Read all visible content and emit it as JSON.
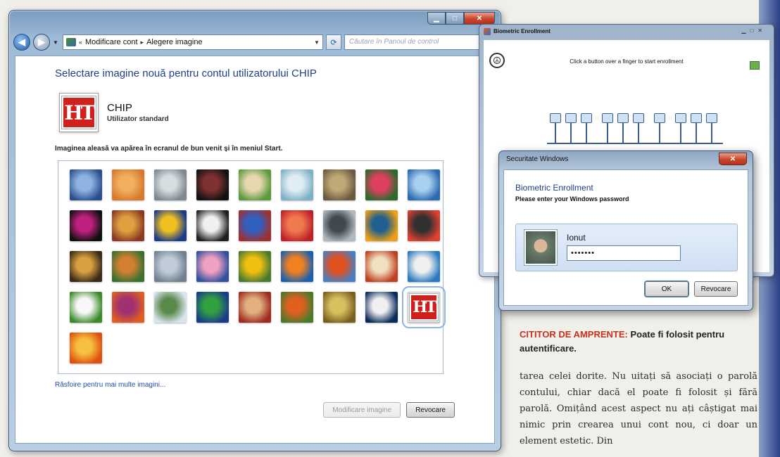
{
  "main_window": {
    "breadcrumb": [
      "Modificare cont",
      "Alegere imagine"
    ],
    "search_placeholder": "Căutare în Panoul de control",
    "title": "Selectare imagine nouă pentru contul utilizatorului CHIP",
    "user": {
      "name": "CHIP",
      "type": "Utilizator standard",
      "logo_text": "HT"
    },
    "instruction": "Imaginea aleasă va apărea în ecranul de bun venit și în meniul Start.",
    "pictures": [
      {
        "name": "robot-arm",
        "colors": [
          "#2a4f8f",
          "#8fb3e0"
        ]
      },
      {
        "name": "starfish",
        "colors": [
          "#d7782a",
          "#f0b060"
        ]
      },
      {
        "name": "robot",
        "colors": [
          "#7d8890",
          "#d8dde0"
        ]
      },
      {
        "name": "record",
        "colors": [
          "#111111",
          "#803030"
        ]
      },
      {
        "name": "cat",
        "colors": [
          "#5a9a3a",
          "#e8d8b0"
        ]
      },
      {
        "name": "gyroscope",
        "colors": [
          "#7fb0c8",
          "#e0eef4"
        ]
      },
      {
        "name": "rocks",
        "colors": [
          "#6a5a40",
          "#c0a878"
        ]
      },
      {
        "name": "flower-red",
        "colors": [
          "#2a6a2a",
          "#e04060"
        ]
      },
      {
        "name": "wheel",
        "colors": [
          "#2a6ab0",
          "#a8d0f0"
        ]
      },
      {
        "name": "ball-swirl",
        "colors": [
          "#101010",
          "#c02080"
        ]
      },
      {
        "name": "fabric",
        "colors": [
          "#8a3a20",
          "#e0a040"
        ]
      },
      {
        "name": "leaf-yellow",
        "colors": [
          "#1a3a8a",
          "#f0c020"
        ]
      },
      {
        "name": "dog",
        "colors": [
          "#202020",
          "#f0f0f0"
        ]
      },
      {
        "name": "crayons",
        "colors": [
          "#a03030",
          "#3060c0"
        ]
      },
      {
        "name": "red-burst",
        "colors": [
          "#c0202a",
          "#f07a50"
        ]
      },
      {
        "name": "jacks",
        "colors": [
          "#b0b8c0",
          "#404850"
        ]
      },
      {
        "name": "stairs",
        "colors": [
          "#f0a010",
          "#206090"
        ]
      },
      {
        "name": "red-flower",
        "colors": [
          "#e04030",
          "#303030"
        ]
      },
      {
        "name": "guitar",
        "colors": [
          "#3a2a18",
          "#d8a040"
        ]
      },
      {
        "name": "pomeranian",
        "colors": [
          "#3a7030",
          "#d08030"
        ]
      },
      {
        "name": "toy-robot",
        "colors": [
          "#708090",
          "#c0ccd8"
        ]
      },
      {
        "name": "textile",
        "colors": [
          "#3050a0",
          "#f0a0c0"
        ]
      },
      {
        "name": "sunflower",
        "colors": [
          "#4a7a30",
          "#f0c010"
        ]
      },
      {
        "name": "fish",
        "colors": [
          "#1a60b0",
          "#f08020"
        ]
      },
      {
        "name": "balloon",
        "colors": [
          "#4a80c0",
          "#e05020"
        ]
      },
      {
        "name": "daruma",
        "colors": [
          "#c04020",
          "#f0e0c0"
        ]
      },
      {
        "name": "sailboat",
        "colors": [
          "#2a7ac0",
          "#f0f0f0"
        ]
      },
      {
        "name": "soccer-ball",
        "colors": [
          "#3a8a2a",
          "#f8f8f8"
        ]
      },
      {
        "name": "pencils",
        "colors": [
          "#e06020",
          "#a03070"
        ]
      },
      {
        "name": "marbles",
        "colors": [
          "#d8e4ee",
          "#5a8a4a"
        ]
      },
      {
        "name": "window",
        "colors": [
          "#1a3a8a",
          "#30a040"
        ]
      },
      {
        "name": "red-lace",
        "colors": [
          "#a02a20",
          "#e0b080"
        ]
      },
      {
        "name": "butterfly",
        "colors": [
          "#4a7a2a",
          "#e06020"
        ]
      },
      {
        "name": "shell-spiral",
        "colors": [
          "#7a6020",
          "#d8c060"
        ]
      },
      {
        "name": "lighthouse",
        "colors": [
          "#0a2a5a",
          "#f0f0f0"
        ]
      },
      {
        "name": "chip-logo",
        "colors": [
          "#d0201e",
          "#ffffff"
        ],
        "selected": true
      },
      {
        "name": "orange-flower",
        "colors": [
          "#e05010",
          "#f8c040"
        ]
      }
    ],
    "browse_link": "Răsfoire pentru mai multe imagini...",
    "btn_change": "Modificare imagine",
    "btn_cancel": "Revocare"
  },
  "bio_window": {
    "title": "Biometric Enrollment",
    "hint": "Click a button over a finger to start enrollment",
    "partial_button": "sh"
  },
  "security_dialog": {
    "title": "Securitate Windows",
    "heading": "Biometric Enrollment",
    "subheading": "Please enter your Windows password",
    "username": "Ionut",
    "password_mask": "•••••••",
    "btn_ok": "OK",
    "btn_cancel": "Revocare"
  },
  "article": {
    "caption_lead": "CITITOR DE AMPRENTE:",
    "caption_rest": " Poate fi folosit pentru autentificare.",
    "body": "tarea celei dorite. Nu uitați să asociați o parolă contului, chiar dacă el poate fi folosit și fără parolă. Omițând acest aspect nu ați câștigat mai nimic prin crearea unui cont nou, ci doar un element estetic. Din"
  }
}
